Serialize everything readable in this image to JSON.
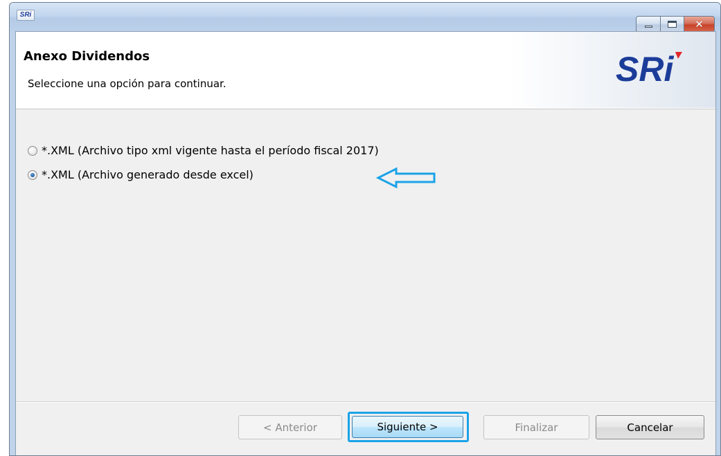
{
  "window": {
    "icon_text": "SRi",
    "controls": {
      "minimize": "minimize-icon",
      "maximize": "maximize-icon",
      "close": "close-icon"
    }
  },
  "header": {
    "title": "Anexo Dividendos",
    "subtitle": "Seleccione una opción para continuar.",
    "logo_text": "SRi",
    "logo_color": "#1c3c99",
    "logo_accent": "#e2262b"
  },
  "options": [
    {
      "label": "*.XML (Archivo tipo xml vigente hasta el período fiscal 2017)",
      "selected": false
    },
    {
      "label": "*.XML (Archivo generado desde excel)",
      "selected": true
    }
  ],
  "annotation": {
    "arrow_color": "#1aa3e8",
    "highlight_color": "#1aa3e8"
  },
  "buttons": {
    "previous": "< Anterior",
    "next": "Siguiente >",
    "finish": "Finalizar",
    "cancel": "Cancelar"
  }
}
